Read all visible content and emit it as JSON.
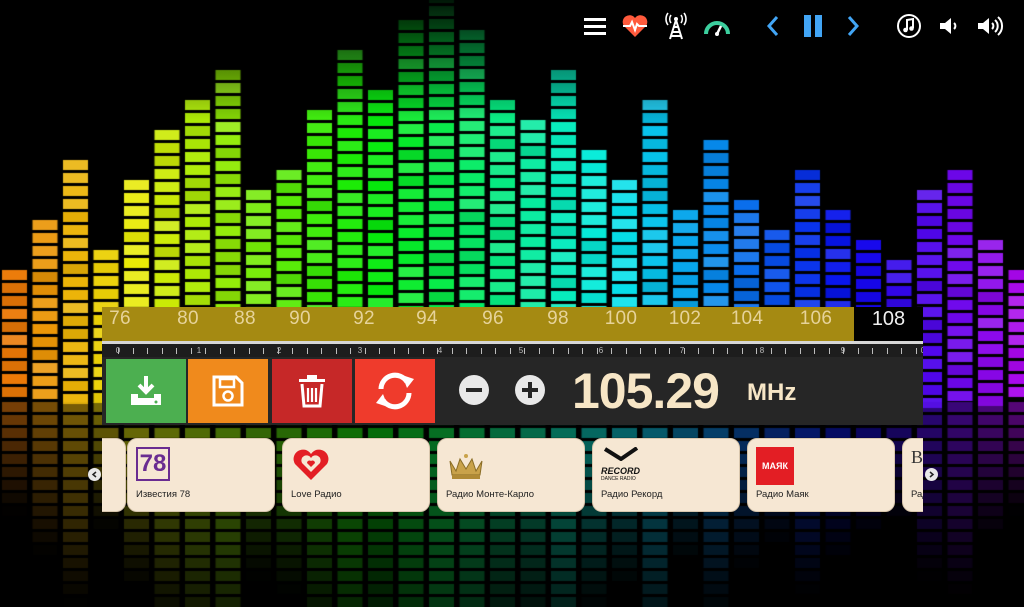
{
  "colors": {
    "accent": "#42a5f5",
    "heart": "#ff5a3c",
    "scale_bg": "#a58a12",
    "freq_text": "#f7e6c6"
  },
  "toolbar": {
    "icons": [
      "menu-icon",
      "heart-pulse-icon",
      "radio-tower-icon",
      "signal-gauge-icon",
      "chevron-left-icon",
      "pause-icon",
      "chevron-right-icon",
      "music-icon",
      "volume-down-icon",
      "volume-up-icon"
    ]
  },
  "scale": {
    "labels": [
      "76",
      "80",
      "88",
      "90",
      "92",
      "94",
      "96",
      "98",
      "100",
      "102",
      "104",
      "106"
    ],
    "end_label": "108",
    "tick_numbers": [
      "0",
      "1",
      "2",
      "3",
      "4",
      "5",
      "6",
      "7",
      "8",
      "9",
      "0"
    ]
  },
  "controls": {
    "buttons": [
      "download-icon",
      "save-icon",
      "trash-icon",
      "refresh-icon"
    ],
    "frequency": "105.29",
    "unit": "MHz"
  },
  "stations": [
    {
      "name": "Известия 78",
      "logo": "78"
    },
    {
      "name": "Love Радио",
      "logo": "heart"
    },
    {
      "name": "Радио Монте-Карло",
      "logo": "crown"
    },
    {
      "name": "Радио Рекорд",
      "logo_title": "RECORD",
      "logo_sub": "DANCE RADIO"
    },
    {
      "name": "Радио Маяк",
      "logo": "МАЯК"
    },
    {
      "name": "Рад",
      "logo": "ВЕ"
    }
  ]
}
